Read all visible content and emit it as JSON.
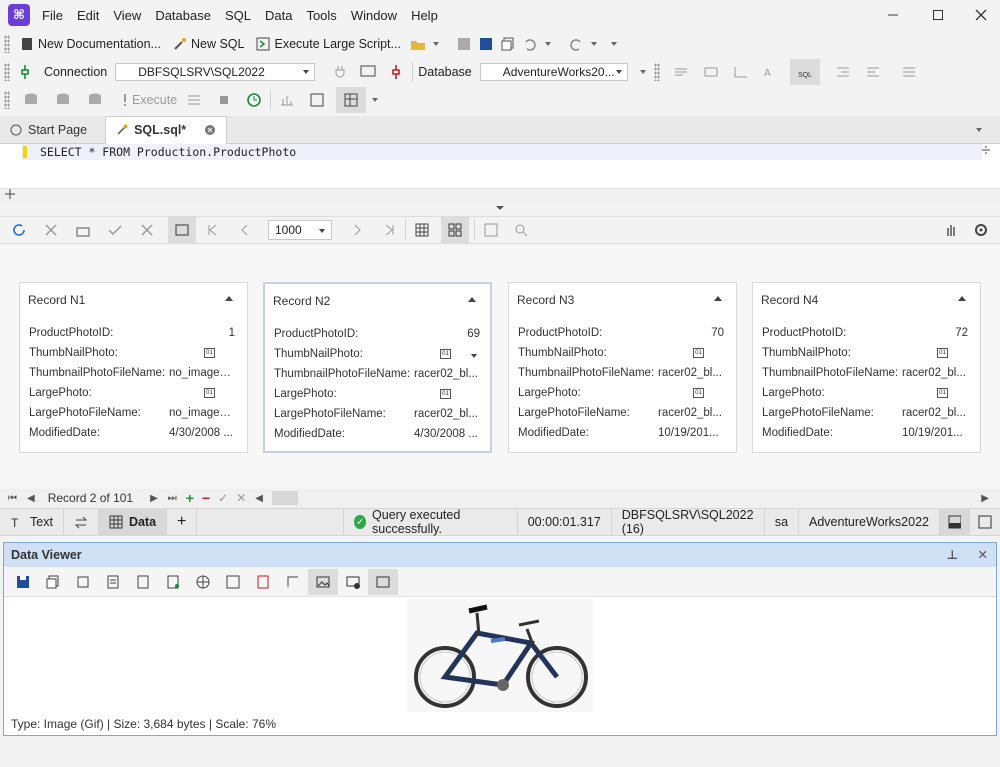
{
  "menu": [
    "File",
    "Edit",
    "View",
    "Database",
    "SQL",
    "Data",
    "Tools",
    "Window",
    "Help"
  ],
  "toolbar1": {
    "new_documentation": "New Documentation...",
    "new_sql": "New SQL",
    "execute_large_script": "Execute Large Script..."
  },
  "toolbar2": {
    "connection_label": "Connection",
    "connection_value": "DBFSQLSRV\\SQL2022",
    "database_label": "Database",
    "database_value": "AdventureWorks20..."
  },
  "toolbar3": {
    "execute_label": "Execute"
  },
  "tabs": [
    {
      "label": "Start Page"
    },
    {
      "label": "SQL.sql*"
    }
  ],
  "editor": {
    "sql": "SELECT * FROM Production.ProductPhoto"
  },
  "results": {
    "page_size": "1000"
  },
  "record_labels": {
    "ProductPhotoID": "ProductPhotoID:",
    "ThumbNailPhoto": "ThumbNailPhoto:",
    "ThumbnailPhotoFileName": "ThumbnailPhotoFileName:",
    "LargePhoto": "LargePhoto:",
    "LargePhotoFileName": "LargePhotoFileName:",
    "ModifiedDate": "ModifiedDate:"
  },
  "records": [
    {
      "title": "Record N1",
      "id": "1",
      "thumb_file": "no_image_...",
      "large_file": "no_image_...",
      "modified": "4/30/2008 ..."
    },
    {
      "title": "Record N2",
      "id": "69",
      "thumb_file": "racer02_bl...",
      "large_file": "racer02_bl...",
      "modified": "4/30/2008 ..."
    },
    {
      "title": "Record N3",
      "id": "70",
      "thumb_file": "racer02_bl...",
      "large_file": "racer02_bl...",
      "modified": "10/19/201..."
    },
    {
      "title": "Record N4",
      "id": "72",
      "thumb_file": "racer02_bl...",
      "large_file": "racer02_bl...",
      "modified": "10/19/201..."
    }
  ],
  "blob_glyph": "01",
  "navigator": {
    "position": "Record 2 of 101"
  },
  "bottom": {
    "text_tab": "Text",
    "data_tab": "Data",
    "status": "Query executed successfully.",
    "elapsed": "00:00:01.317",
    "server": "DBFSQLSRV\\SQL2022 (16)",
    "user": "sa",
    "database": "AdventureWorks2022"
  },
  "data_viewer": {
    "title": "Data Viewer",
    "info": "Type: Image (Gif) | Size: 3,684 bytes | Scale: 76%"
  },
  "colors": {
    "accent": "#6b3fd6",
    "success": "#2aa84a",
    "viewer_header": "#cfe0f4"
  }
}
